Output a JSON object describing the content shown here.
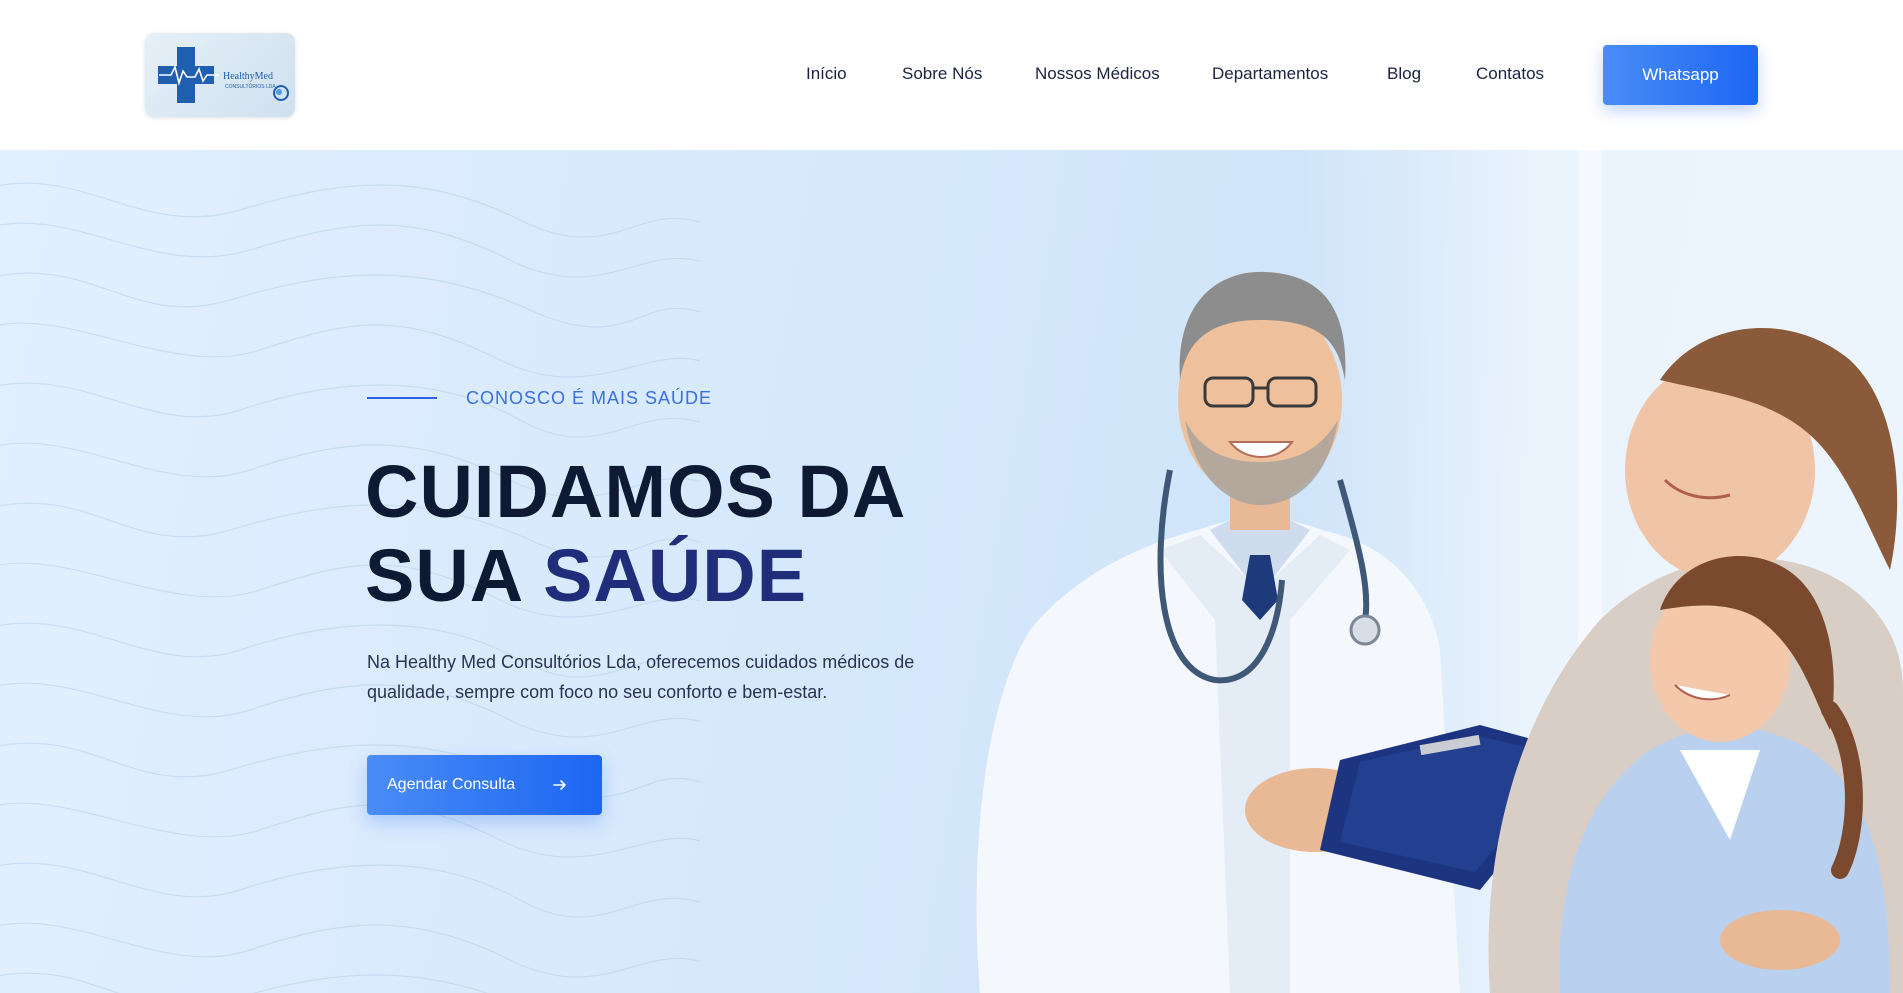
{
  "header": {
    "logo_alt": "HealthyMed Consultórios Lda",
    "logo_text_main": "HealthyMed",
    "logo_text_sub": "CONSULTÓRIOS LDA",
    "nav": [
      {
        "label": "Início"
      },
      {
        "label": "Sobre Nós"
      },
      {
        "label": "Nossos Médicos"
      },
      {
        "label": "Departamentos"
      },
      {
        "label": "Blog"
      },
      {
        "label": "Contatos"
      }
    ],
    "whatsapp_label": "Whatsapp"
  },
  "hero": {
    "eyebrow": "CONOSCO É MAIS SAÚDE",
    "title_line1": "CUIDAMOS DA",
    "title_line2_plain": "SUA ",
    "title_line2_accent": "SAÚDE",
    "description": "Na Healthy Med Consultórios Lda, oferecemos cuidados médicos de qualidade, sempre com foco no seu conforto e bem-estar.",
    "cta_label": "Agendar Consulta",
    "cta_icon": "arrow-right-icon"
  },
  "colors": {
    "primary": "#1c66f2",
    "primary_light": "#4a8cf7",
    "title_dark": "#0e1a33",
    "title_accent": "#1f2d7a",
    "eyebrow": "#3b6fe0",
    "hero_bg": "#d5e8fc"
  }
}
